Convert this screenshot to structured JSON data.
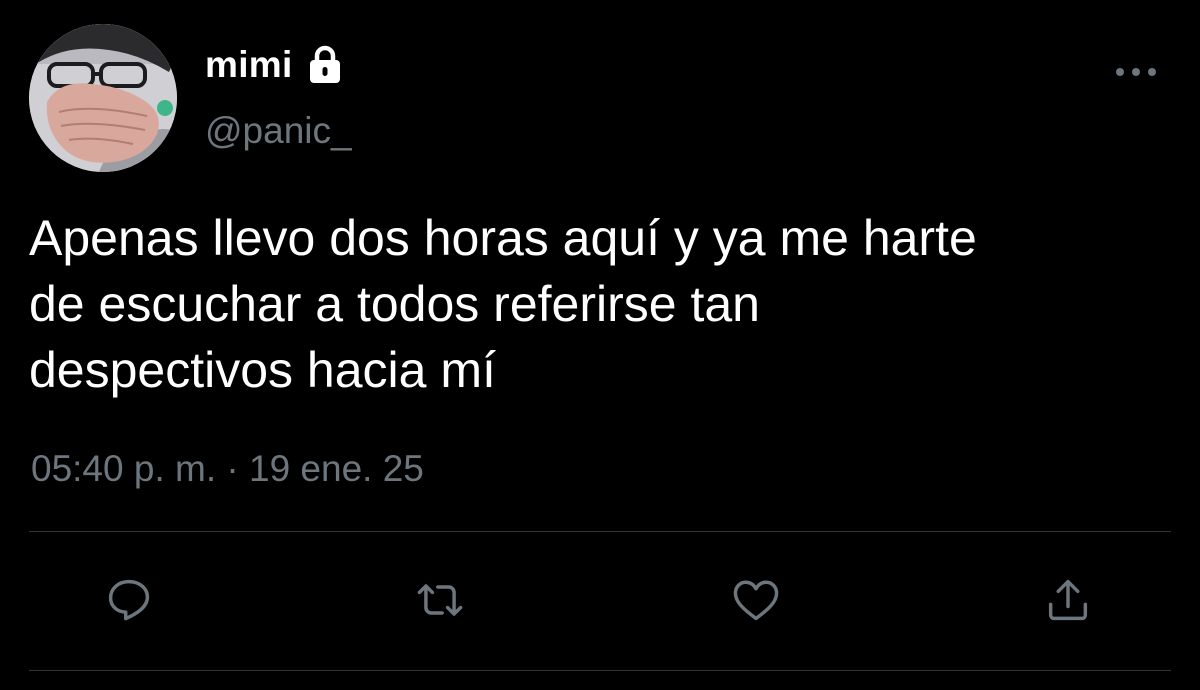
{
  "tweet": {
    "author": {
      "display_name": "mimi",
      "handle": "@panic_",
      "protected_icon": "lock-icon",
      "avatar": "profile-photo"
    },
    "more_icon": "more-horizontal-icon",
    "text_lines": [
      "Apenas llevo dos horas aquí y ya me harte",
      "de escuchar a todos referirse tan",
      "despectivos hacia mí"
    ],
    "time": "05:40 p. m.",
    "separator": "·",
    "date": "19 ene. 25",
    "actions": [
      {
        "name": "reply",
        "icon": "reply-icon"
      },
      {
        "name": "retweet",
        "icon": "retweet-icon"
      },
      {
        "name": "like",
        "icon": "heart-icon"
      },
      {
        "name": "share",
        "icon": "share-icon"
      }
    ]
  },
  "colors": {
    "background": "#000000",
    "text": "#ffffff",
    "secondary_text": "#6e767d",
    "divider": "#2f3336",
    "icon": "#6e767d"
  }
}
